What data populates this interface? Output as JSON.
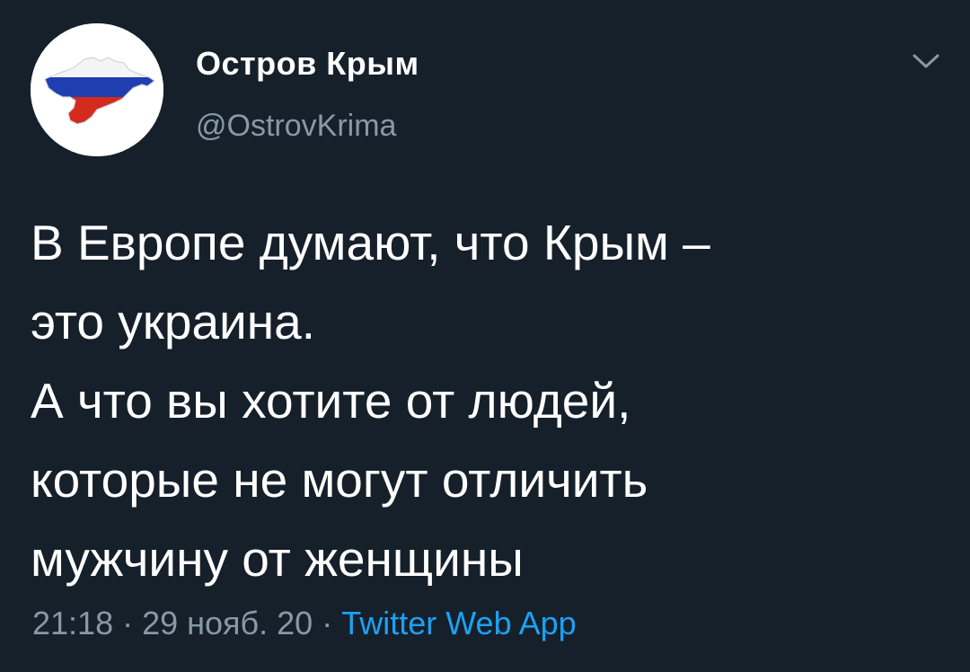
{
  "author": {
    "display_name": "Остров Крым",
    "handle": "@OstrovKrima",
    "avatar_icon": "crimea-flag-map-icon"
  },
  "tweet": {
    "lines": [
      "В Европе думают, что Крым –",
      "это украина.",
      "А что вы хотите от людей,",
      "которые не могут отличить",
      "мужчину от женщины"
    ]
  },
  "meta": {
    "time": "21:18",
    "date": "29 нояб. 20",
    "separator": "·",
    "source": "Twitter Web App"
  },
  "menu_icon": "chevron-down-icon",
  "colors": {
    "background": "#15202b",
    "text": "#ffffff",
    "secondary_text": "#8899a6",
    "link": "#1da1f2"
  }
}
